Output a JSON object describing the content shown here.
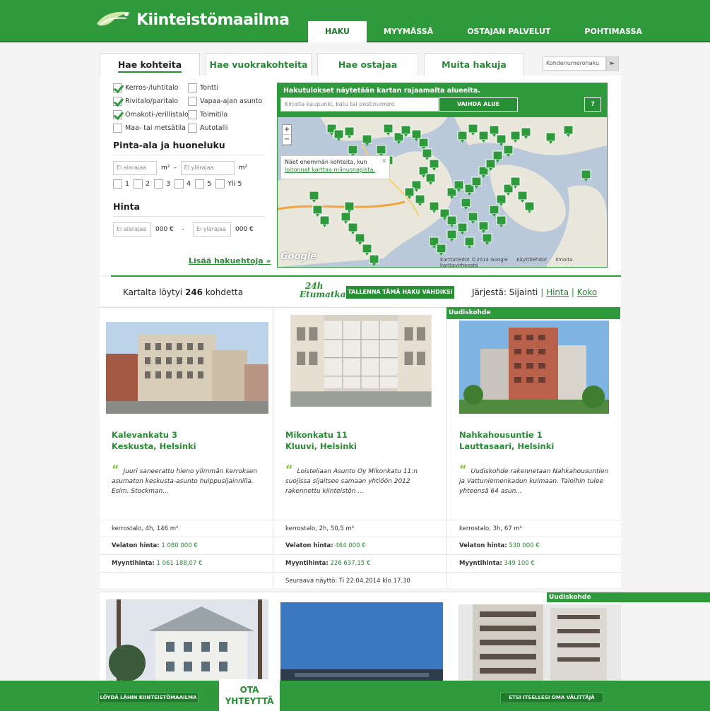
{
  "header": {
    "logo_text": "Kiinteistömaailma",
    "nav": [
      "HAKU",
      "MYYMÄSSÄ",
      "OSTAJAN PALVELUT",
      "POHTIMASSA"
    ]
  },
  "search": {
    "tabs": [
      "Hae kohteita",
      "Hae vuokrakohteita",
      "Hae ostajaa",
      "Muita hakuja"
    ],
    "kohde_placeholder": "Kohdenumerohaku",
    "types": [
      {
        "label": "Kerros-/luhtitalo",
        "checked": true
      },
      {
        "label": "Tontti",
        "checked": false
      },
      {
        "label": "Rivitalo/paritalo",
        "checked": true
      },
      {
        "label": "Vapaa-ajan asunto",
        "checked": false
      },
      {
        "label": "Omakoti-/erillistalo",
        "checked": true
      },
      {
        "label": "Toimitila",
        "checked": false
      },
      {
        "label": "Maa- tai metsätila",
        "checked": false
      },
      {
        "label": "Autotalli",
        "checked": false
      }
    ],
    "area_title": "Pinta-ala ja huoneluku",
    "area_min": "Ei alarajaa",
    "area_max": "Ei ylärajaa",
    "area_unit": "m²",
    "dash": "-",
    "rooms": [
      "1",
      "2",
      "3",
      "4",
      "5",
      "Yli 5"
    ],
    "price_title": "Hinta",
    "price_min": "Ei alarajaa",
    "price_max": "Ei ylärajaa",
    "price_unit": "000 €",
    "more_link": "Lisää hakuehtoja »"
  },
  "map": {
    "header": "Hakutulokset näytetään kartan rajaamalta alueelta.",
    "input_placeholder": "Kirjoita kaupunki, katu tai postinumero",
    "change_button": "VAIHDA ALUE",
    "help": "?",
    "zoom_in": "+",
    "zoom_out": "−",
    "tooltip_text": "Näet enemmän kohteita, kun",
    "tooltip_link": "loitonnat karttaa miinusnapista.",
    "tooltip_close": "×",
    "google": "Google",
    "credits": [
      "Karttatiedot ©2014 Google",
      "Käyttöehdot",
      "Ilmoita karttavirheestä"
    ]
  },
  "results": {
    "prefix": "Kartalta löytyi",
    "count": "246",
    "suffix": "kohdetta",
    "etumatka_1": "24h",
    "etumatka_2": "Etumatka",
    "save_button": "TALLENNA TÄMÄ HAKU VAHDIKSI",
    "sort_label": "Järjestä:",
    "sort_current": "Sijainti",
    "sort_options": [
      "Hinta",
      "Koko"
    ],
    "sort_sep": "|"
  },
  "listings": [
    {
      "badge": "",
      "street": "Kalevankatu 3",
      "area": "Keskusta, Helsinki",
      "description": "Juuri saneerattu hieno ylimmän kerroksen asumaton keskusta-asunto huippusijainnilla. Esim. Stockman...",
      "size": "kerrostalo, 4h, 146 m²",
      "velaton_label": "Velaton hinta:",
      "velaton": "1 080 000 €",
      "myynti_label": "Myyntihinta:",
      "myynti": "1 061 188,07 €",
      "showing": ""
    },
    {
      "badge": "",
      "street": "Mikonkatu 11",
      "area": "Kluuvi, Helsinki",
      "description": "Loisteliaan Asunto Oy Mikonkatu 11:n suojissa sijaitsee samaan yhtiöön 2012 rakennettu kiinteistön ...",
      "size": "kerrostalo, 2h, 50,5 m²",
      "velaton_label": "Velaton hinta:",
      "velaton": "464 000 €",
      "myynti_label": "Myyntihinta:",
      "myynti": "226 637,15 €",
      "showing": "Seuraava näyttö: Ti 22.04.2014 klo 17.30"
    },
    {
      "badge": "Uudiskohde",
      "street": "Nahkahousuntie 1",
      "area": "Lauttasaari, Helsinki",
      "description": "Uudiskohde rakennetaan Nahkahousuntien ja Vattuniemenkadun kulmaan. Taloihin tulee yhteensä 64 asun...",
      "size": "kerrostalo, 3h, 67 m²",
      "velaton_label": "Velaton hinta:",
      "velaton": "530 000 €",
      "myynti_label": "Myyntihinta:",
      "myynti": "349 100 €",
      "showing": ""
    }
  ],
  "row2_badge": "Uudiskohde",
  "quote_mark": "“",
  "footer": {
    "find_office": "LÖYDÄ LÄHIN KIINTEISTÖMAAILMA",
    "contact_1": "OTA",
    "contact_2": "YHTEYTTÄ",
    "find_agent": "ETSI ITSELLESI OMA VÄLITTÄJÄ"
  },
  "colors": {
    "brand_green": "#2f9a3c",
    "link_green": "#2a8b36",
    "quote_green": "#7cbf3a"
  }
}
